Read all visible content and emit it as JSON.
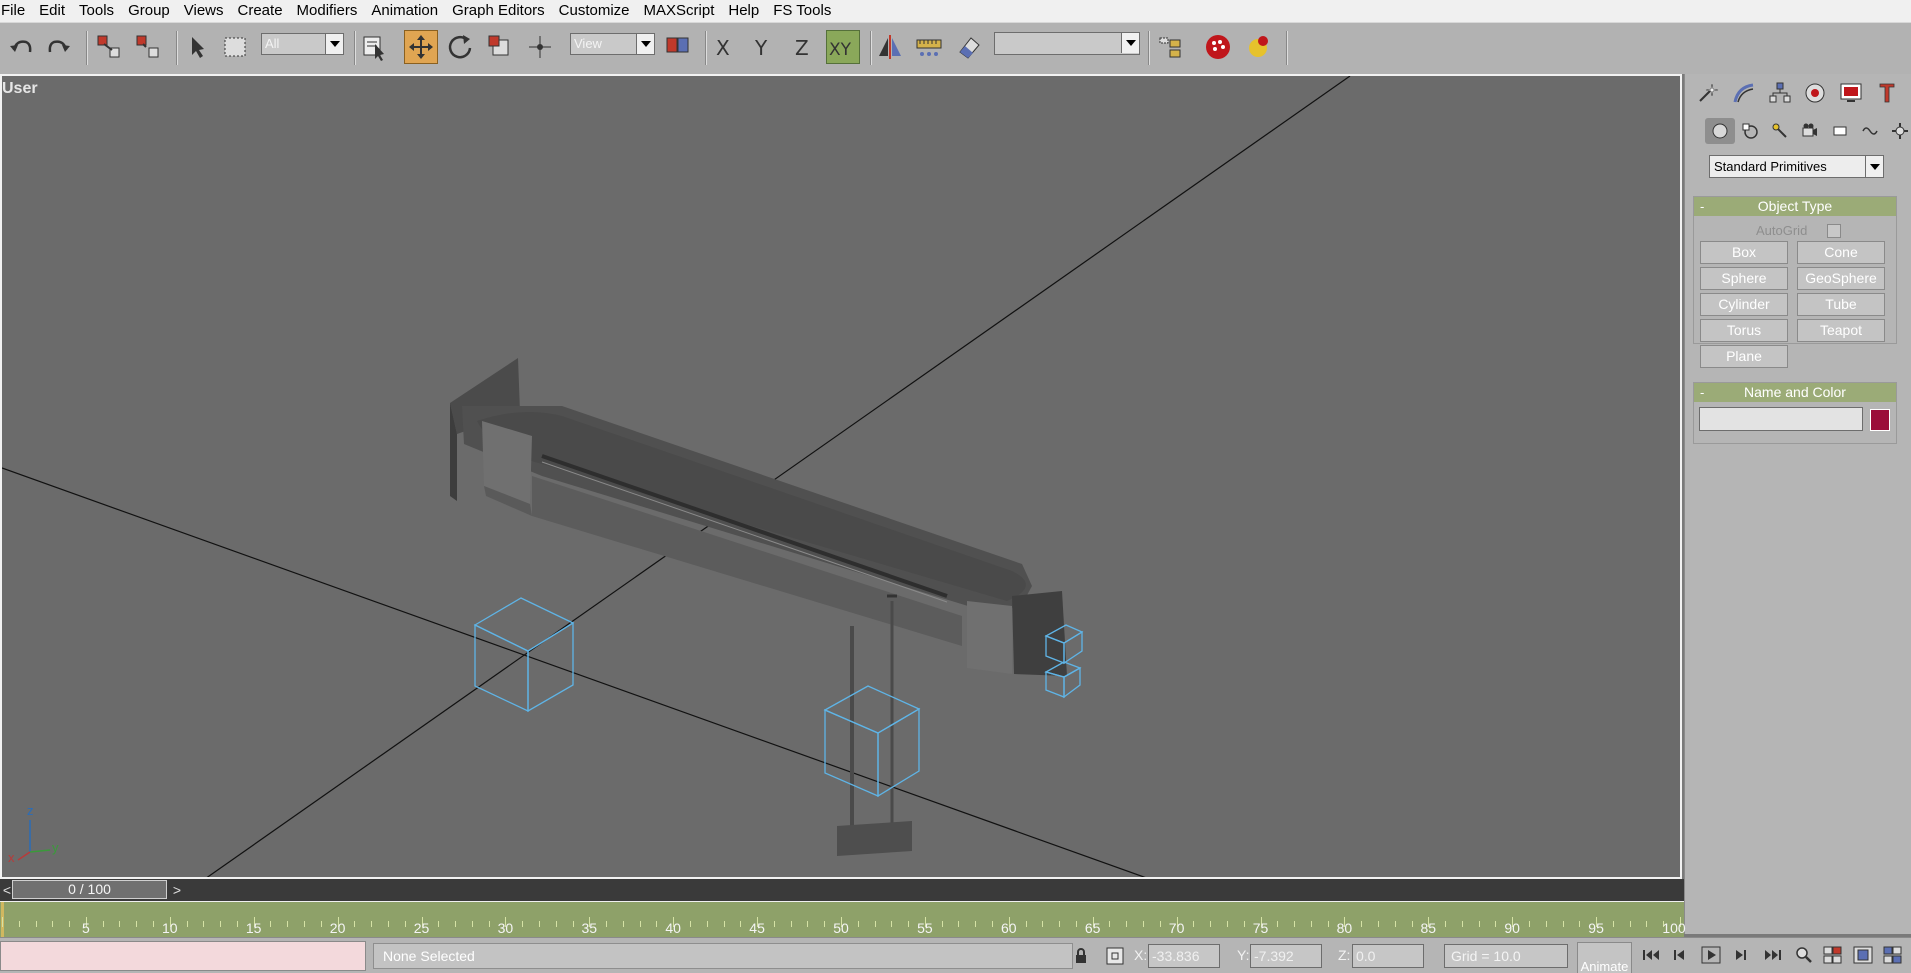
{
  "menu": [
    "File",
    "Edit",
    "Tools",
    "Group",
    "Views",
    "Create",
    "Modifiers",
    "Animation",
    "Graph Editors",
    "Customize",
    "MAXScript",
    "Help",
    "FS Tools"
  ],
  "toolbar": {
    "selection_filter": "All",
    "ref_coord": "View",
    "named_selection": "",
    "icons": [
      "undo-icon",
      "redo-icon",
      "link-icon",
      "unlink-icon",
      "select-icon",
      "rect-region-icon",
      "select-by-name-icon",
      "move-icon",
      "rotate-icon",
      "scale-icon",
      "pivot-icon",
      "mirror-icon",
      "axis-x-icon",
      "axis-y-icon",
      "axis-z-icon",
      "axis-xy-icon",
      "align-icon",
      "ruler-icon",
      "eraser-icon",
      "layer-icon",
      "render-icon",
      "teapot-icon"
    ],
    "axis_labels": {
      "x": "X",
      "y": "Y",
      "z": "Z",
      "xy": "XY"
    },
    "active_tool": "move",
    "active_axis": "xy"
  },
  "viewport": {
    "label": "User",
    "axis": {
      "x": "x",
      "y": "y",
      "z": "z"
    },
    "colors": {
      "background": "#6b6b6b",
      "helper": "#5fb4e6",
      "grid": "#111111"
    }
  },
  "command_panel": {
    "tabs": [
      "create-tab-icon",
      "modify-tab-icon",
      "hierarchy-tab-icon",
      "motion-tab-icon",
      "display-tab-icon",
      "utilities-tab-icon"
    ],
    "subtabs": [
      "geometry-icon",
      "shapes-icon",
      "lights-icon",
      "cameras-icon",
      "helpers-icon",
      "space-warps-icon",
      "systems-icon"
    ],
    "category": "Standard Primitives",
    "object_type": {
      "title": "Object Type",
      "autogrid": "AutoGrid",
      "buttons": [
        "Box",
        "Cone",
        "Sphere",
        "GeoSphere",
        "Cylinder",
        "Tube",
        "Torus",
        "Teapot",
        "Plane"
      ]
    },
    "name_color": {
      "title": "Name and Color",
      "name_value": "",
      "color": "#9b0d3a"
    },
    "collapse_symbol": "-"
  },
  "timeline": {
    "frame_display": "0 / 100",
    "prev": "<",
    "next": ">",
    "ticks": [
      5,
      10,
      15,
      20,
      25,
      30,
      35,
      40,
      45,
      50,
      55,
      60,
      65,
      70,
      75,
      80,
      85,
      90,
      95,
      100
    ]
  },
  "status": {
    "selection": "None Selected",
    "x_label": "X:",
    "x_value": "-33.836",
    "y_label": "Y:",
    "y_value": "-7.392",
    "z_label": "Z:",
    "z_value": "0.0",
    "grid": "Grid = 10.0",
    "animate": "Animate"
  }
}
